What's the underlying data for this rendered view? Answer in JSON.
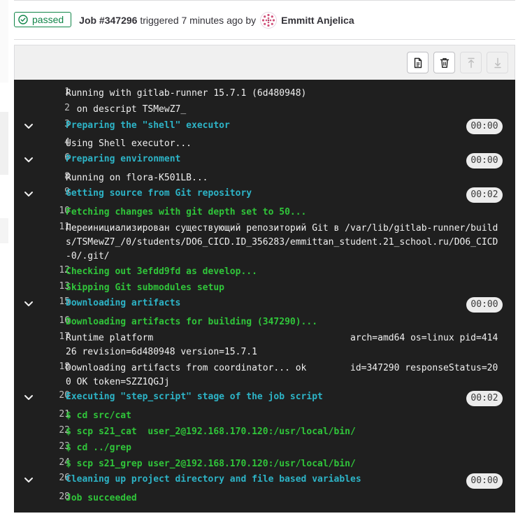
{
  "job": {
    "status": "passed",
    "id_label": "Job #347296",
    "triggered_text": "triggered 7 minutes ago by",
    "author": "Emmitt Anjelica"
  },
  "toolbar": {
    "buttons": [
      "show-raw-icon",
      "erase-log-icon",
      "scroll-top-icon",
      "scroll-bottom-icon"
    ]
  },
  "colors": {
    "passed": "#108548",
    "log_bg": "#1f1f1f",
    "section": "#2db4c7",
    "success": "#30c53a"
  },
  "log": {
    "lines": [
      {
        "n": "1",
        "text": "Running with gitlab-runner 15.7.1 (6d480948)"
      },
      {
        "n": "2",
        "text": "  on descript TSMewZ7_"
      },
      {
        "n": "3",
        "text": "Preparing the \"shell\" executor",
        "duration": "00:00"
      },
      {
        "n": "4",
        "text": "Using Shell executor..."
      },
      {
        "n": "6",
        "text": "Preparing environment",
        "duration": "00:00"
      },
      {
        "n": "8",
        "text": "Running on flora-K501LB..."
      },
      {
        "n": "9",
        "text": "Getting source from Git repository",
        "duration": "00:02"
      },
      {
        "n": "10",
        "text": "Fetching changes with git depth set to 50..."
      },
      {
        "n": "11",
        "text": "Переинициализирован существующий репозиторий Git в /var/lib/gitlab-runner/builds/TSMewZ7_/0/students/DO6_CICD.ID_356283/emmittan_student.21_school.ru/DO6_CICD-0/.git/"
      },
      {
        "n": "12",
        "text": "Checking out 3efdd9fd as develop..."
      },
      {
        "n": "13",
        "text": "Skipping Git submodules setup"
      },
      {
        "n": "15",
        "text": "Downloading artifacts",
        "duration": "00:00"
      },
      {
        "n": "16",
        "text": "Downloading artifacts for building (347290)..."
      },
      {
        "n": "17",
        "text": "Runtime platform                                    arch=amd64 os=linux pid=41426 revision=6d480948 version=15.7.1"
      },
      {
        "n": "18",
        "text": "Downloading artifacts from coordinator... ok        id=347290 responseStatus=200 OK token=SZZ1QGJj"
      },
      {
        "n": "20",
        "text": "Executing \"step_script\" stage of the job script",
        "duration": "00:02"
      },
      {
        "n": "21",
        "text": "$ cd src/cat"
      },
      {
        "n": "22",
        "text": "$ scp s21_cat  user_2@192.168.170.120:/usr/local/bin/"
      },
      {
        "n": "23",
        "text": "$ cd ../grep"
      },
      {
        "n": "24",
        "text": "$ scp s21_grep user_2@192.168.170.120:/usr/local/bin/"
      },
      {
        "n": "26",
        "text": "Cleaning up project directory and file based variables",
        "duration": "00:00"
      },
      {
        "n": "28",
        "text": "Job succeeded"
      }
    ]
  }
}
